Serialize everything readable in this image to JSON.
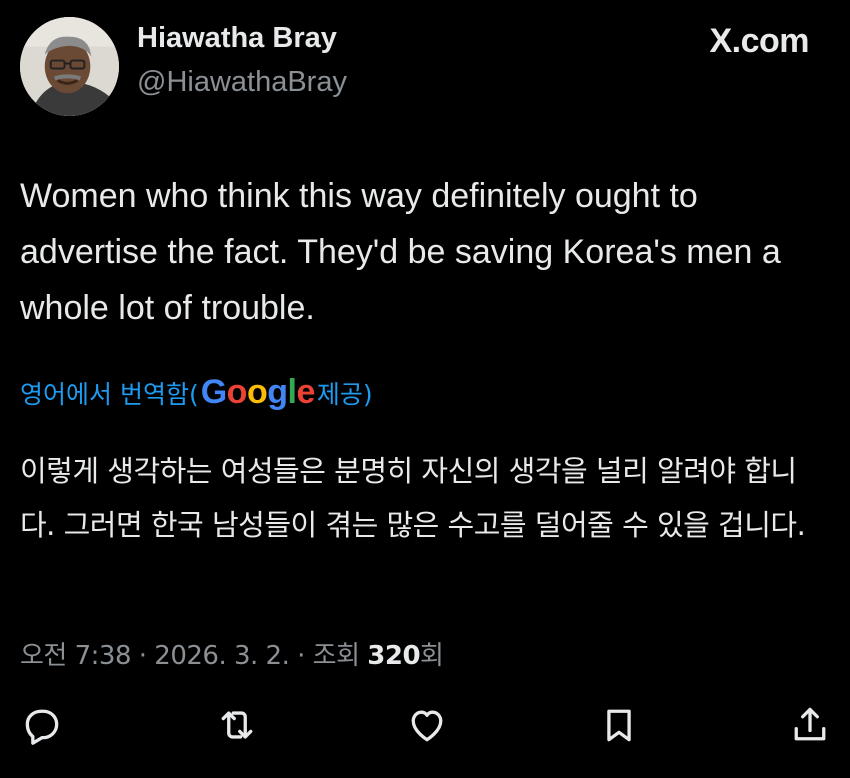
{
  "author": {
    "display_name": "Hiawatha Bray",
    "handle": "@HiawathaBray"
  },
  "source_label": "X.com",
  "tweet": {
    "text": "Women who think this way definitely ought to advertise the fact. They'd be saving Korea's men a whole lot of trouble."
  },
  "translation": {
    "label_prefix": "영어에서 번역함(",
    "logo_text": "Google",
    "label_suffix": " 제공)",
    "text": "이렇게 생각하는 여성들은 분명히 자신의 생각을 널리 알려야 합니다. 그러면 한국 남성들이 겪는 많은 수고를 덜어줄 수 있을 겁니다."
  },
  "meta": {
    "time_date": "오전 7:38 · 2026. 3. 2. · 조회 ",
    "views": "320",
    "views_suffix": "회"
  },
  "actions": {
    "reply_icon": "reply-icon",
    "retweet_icon": "retweet-icon",
    "like_icon": "heart-icon",
    "bookmark_icon": "bookmark-icon",
    "share_icon": "share-icon"
  },
  "colors": {
    "background": "#000000",
    "text_primary": "#e7e9ea",
    "text_secondary": "#8b9095",
    "link": "#1d9bf0"
  }
}
